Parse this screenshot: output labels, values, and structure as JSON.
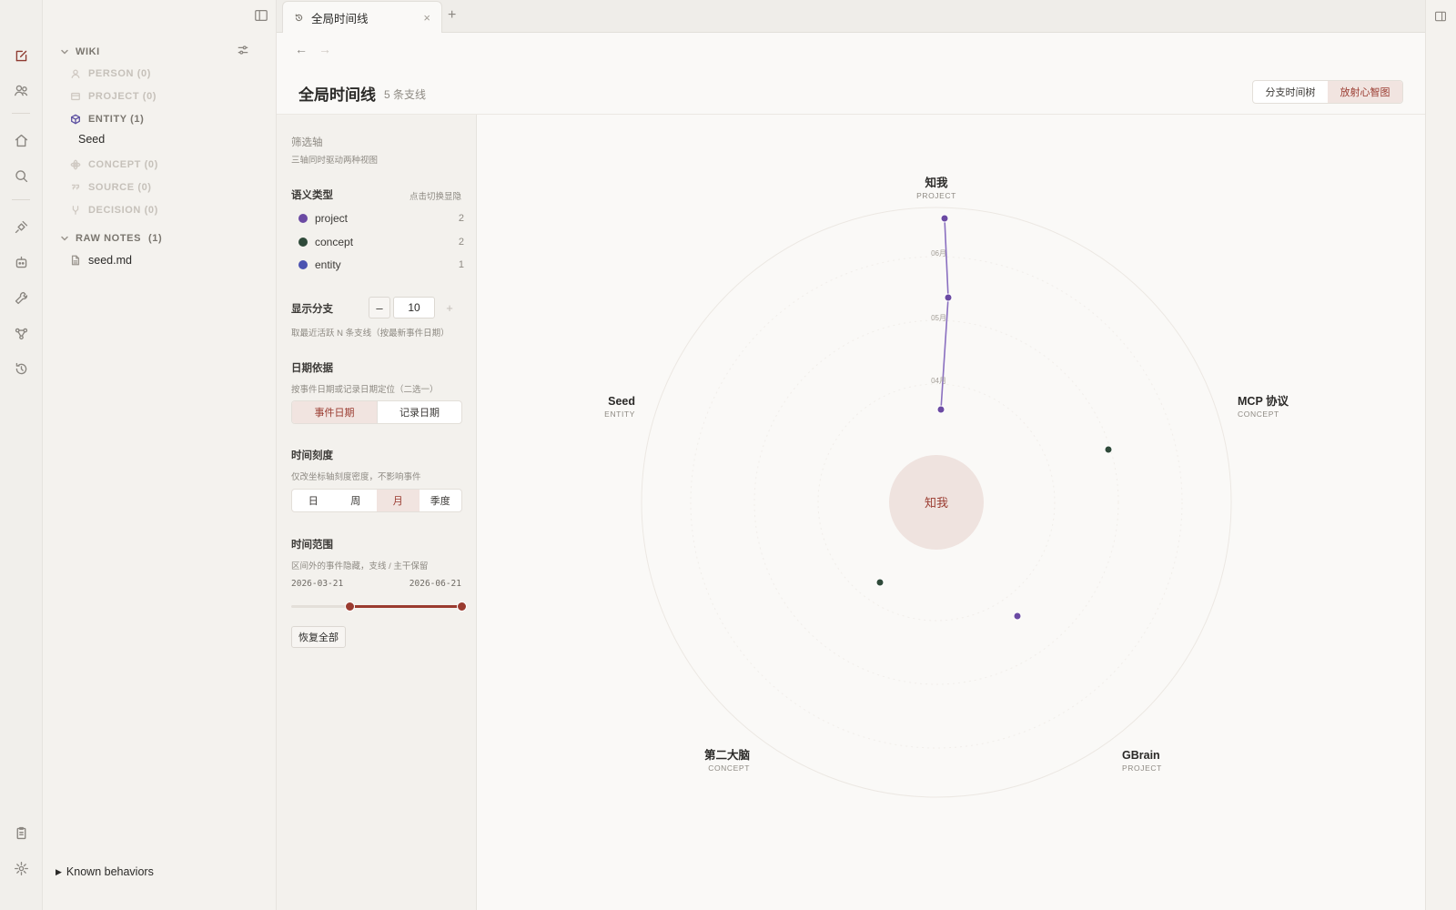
{
  "tab": {
    "title": "全局时间线"
  },
  "sidebar": {
    "wiki_label": "WIKI",
    "categories": [
      {
        "label": "PERSON (0)"
      },
      {
        "label": "PROJECT (0)"
      },
      {
        "label": "ENTITY (1)"
      },
      {
        "label": "CONCEPT (0)"
      },
      {
        "label": "SOURCE (0)"
      },
      {
        "label": "DECISION (0)"
      }
    ],
    "entity_child": "Seed",
    "raw_notes_label": "RAW NOTES",
    "raw_notes_count": "(1)",
    "raw_note_file": "seed.md",
    "known_behaviors": "Known behaviors"
  },
  "header": {
    "title": "全局时间线",
    "subtitle": "5 条支线",
    "view_tree": "分支时间树",
    "view_radial": "放射心智图"
  },
  "filter": {
    "axis_title": "筛选轴",
    "axis_sub": "三轴同时驱动两种视图",
    "semantic_title": "语义类型",
    "semantic_hint": "点击切换显隐",
    "types": [
      {
        "name": "project",
        "count": "2",
        "color": "#6b4aa3"
      },
      {
        "name": "concept",
        "count": "2",
        "color": "#2f4a3a"
      },
      {
        "name": "entity",
        "count": "1",
        "color": "#4b52b0"
      }
    ],
    "branch_title": "显示分支",
    "branch_value": "10",
    "branch_minus": "–",
    "branch_plus": "+",
    "branch_sub": "取最近活跃 N 条支线（按最新事件日期）",
    "date_title": "日期依据",
    "date_sub": "按事件日期或记录日期定位（二选一）",
    "date_opt_event": "事件日期",
    "date_opt_record": "记录日期",
    "scale_title": "时间刻度",
    "scale_sub": "仅改坐标轴刻度密度，不影响事件",
    "scale_opts": [
      "日",
      "周",
      "月",
      "季度"
    ],
    "range_title": "时间范围",
    "range_sub": "区间外的事件隐藏，支线 / 主干保留",
    "range_start": "2026-03-21",
    "range_end": "2026-06-21",
    "range_fill_start": 0.34,
    "range_fill_end": 1.0,
    "reset": "恢复全部"
  },
  "radial": {
    "center_label": "知我",
    "branches": [
      {
        "name": "知我",
        "type": "PROJECT"
      },
      {
        "name": "MCP 协议",
        "type": "CONCEPT"
      },
      {
        "name": "GBrain",
        "type": "PROJECT"
      },
      {
        "name": "第二大脑",
        "type": "CONCEPT"
      },
      {
        "name": "Seed",
        "type": "ENTITY"
      }
    ],
    "month_ticks": [
      "06月",
      "05月",
      "04月"
    ],
    "colors": {
      "project": "#6b4aa3",
      "concept": "#2f4a3a",
      "entity": "#4b52b0",
      "accent": "#9a3b30"
    }
  }
}
